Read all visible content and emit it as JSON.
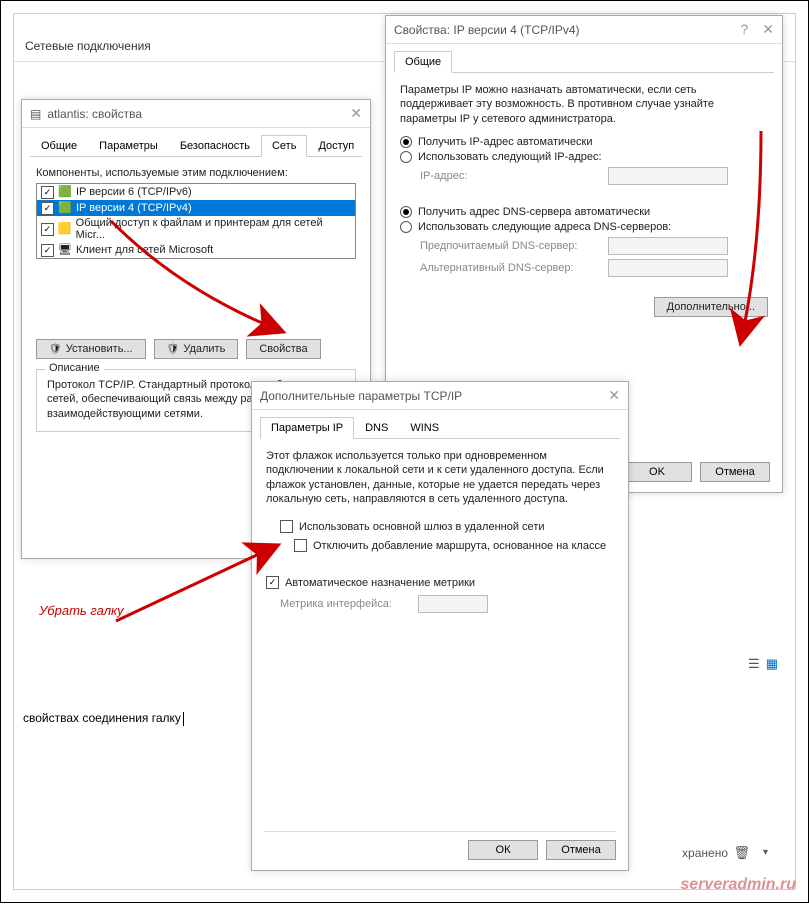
{
  "bg": {
    "title": "Сетевые подключения"
  },
  "win1": {
    "title": "atlantis: свойства",
    "tabs": [
      "Общие",
      "Параметры",
      "Безопасность",
      "Сеть",
      "Доступ"
    ],
    "active_tab": 3,
    "list_label": "Компоненты, используемые этим подключением:",
    "items": [
      {
        "label": "IP версии 6 (TCP/IPv6)",
        "checked": true,
        "sel": false
      },
      {
        "label": "IP версии 4 (TCP/IPv4)",
        "checked": true,
        "sel": true
      },
      {
        "label": "Общий доступ к файлам и принтерам для сетей Micr...",
        "checked": true,
        "sel": false
      },
      {
        "label": "Клиент для сетей Microsoft",
        "checked": true,
        "sel": false
      }
    ],
    "btn_install": "Установить...",
    "btn_remove": "Удалить",
    "btn_props": "Свойства",
    "desc_title": "Описание",
    "desc_text": "Протокол TCP/IP. Стандартный протокол глобальных сетей, обеспечивающий связь между различными взаимодействующими сетями."
  },
  "win2": {
    "title": "Свойства: IP версии 4 (TCP/IPv4)",
    "tab": "Общие",
    "intro": "Параметры IP можно назначать автоматически, если сеть поддерживает эту возможность. В противном случае узнайте параметры IP у сетевого администратора.",
    "r1a": "Получить IP-адрес автоматически",
    "r1b": "Использовать следующий IP-адрес:",
    "f_ip": "IP-адрес:",
    "r2a": "Получить адрес DNS-сервера автоматически",
    "r2b": "Использовать следующие адреса DNS-серверов:",
    "f_dns1": "Предпочитаемый DNS-сервер:",
    "f_dns2": "Альтернативный DNS-сервер:",
    "btn_adv": "Дополнительно...",
    "btn_ok": "OK",
    "btn_cancel": "Отмена"
  },
  "win3": {
    "title": "Дополнительные параметры TCP/IP",
    "tabs": [
      "Параметры IP",
      "DNS",
      "WINS"
    ],
    "intro": "Этот флажок используется только при одновременном подключении к локальной сети и к сети удаленного доступа. Если флажок установлен, данные, которые не удается передать через локальную сеть, направляются в сеть удаленного доступа.",
    "c1": "Использовать основной шлюз в удаленной сети",
    "c2": "Отключить добавление маршрута, основанное на классе",
    "c3": "Автоматическое назначение метрики",
    "f_metric": "Метрика интерфейса:",
    "btn_ok": "ОК",
    "btn_cancel": "Отмена"
  },
  "annot": {
    "remove": "Убрать галку"
  },
  "bottom": {
    "text": "свойствах соединения галку"
  },
  "status": {
    "saved": "хранено"
  },
  "watermark": "serveradmin.ru"
}
